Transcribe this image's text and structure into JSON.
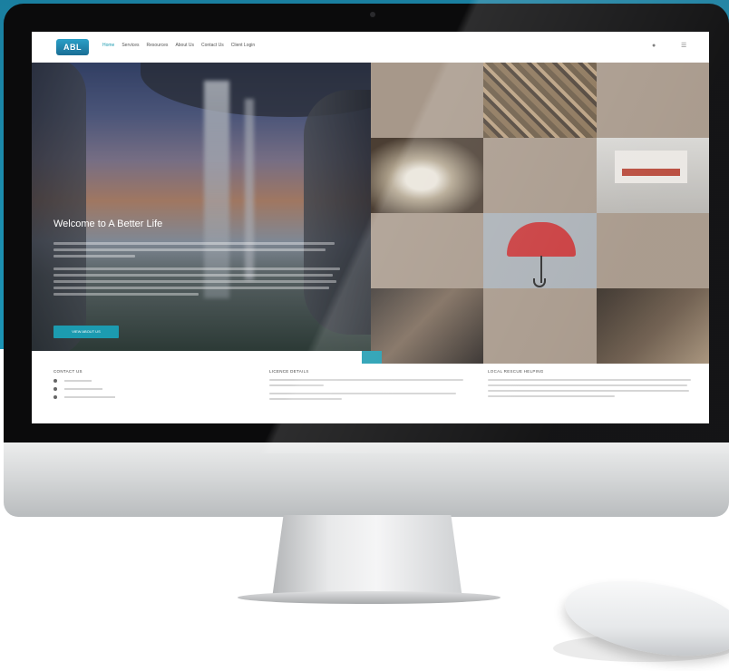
{
  "colors": {
    "accent": "#1c9bb0",
    "backdrop": "#1b8cad",
    "tile": "#a7988a"
  },
  "nav": {
    "logo": "ABL",
    "links": [
      "Home",
      "Services",
      "Resources",
      "About Us",
      "Contact Us",
      "Client Login"
    ],
    "icons": [
      "user-icon",
      "menu-icon"
    ]
  },
  "hero": {
    "title": "Welcome to A Better Life",
    "button_label": "VIEW ABOUT US"
  },
  "tiles": [
    {
      "icon": "",
      "label": ""
    },
    {
      "icon": "",
      "label": ""
    },
    {
      "icon": "",
      "label": ""
    },
    {
      "icon": "",
      "label": ""
    },
    {
      "icon": "",
      "label": ""
    },
    {
      "icon": "",
      "label": ""
    },
    {
      "icon": "",
      "label": ""
    },
    {
      "icon": "umbrella-icon",
      "label": ""
    },
    {
      "icon": "",
      "label": ""
    },
    {
      "icon": "",
      "label": ""
    },
    {
      "icon": "",
      "label": ""
    },
    {
      "icon": "",
      "label": ""
    }
  ],
  "footer": {
    "contact_heading": "CONTACT US",
    "contact_items": [
      "",
      "",
      ""
    ],
    "licence_heading": "LICENCE DETAILS",
    "third_heading": "LOCAL RESCUE HELPING"
  }
}
